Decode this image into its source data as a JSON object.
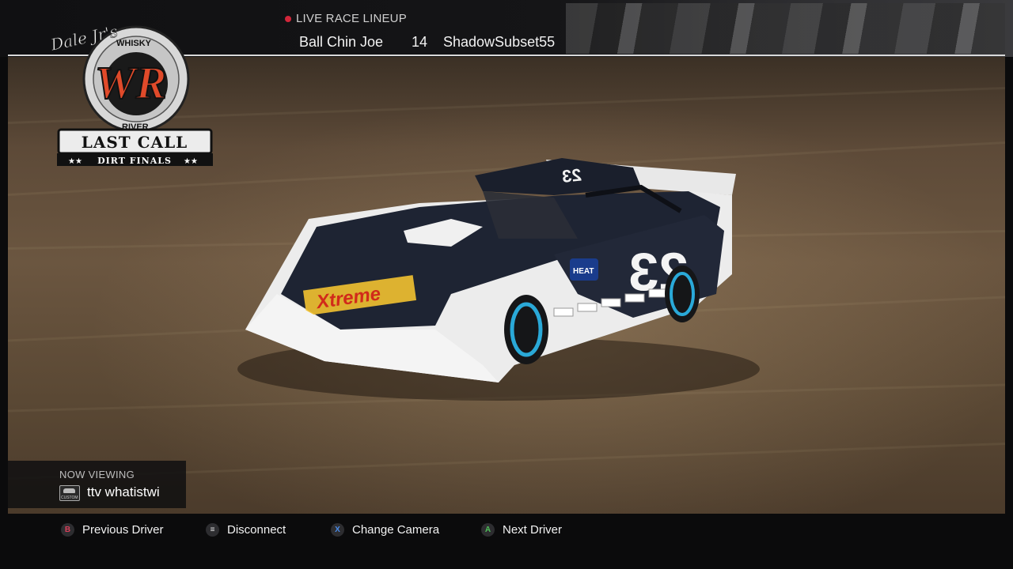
{
  "header": {
    "live_label": "LIVE RACE LINEUP",
    "lineup": {
      "driver_left": "Ball Chin Joe",
      "position": "14",
      "driver_right": "ShadowSubset55"
    },
    "live_dot_color": "#d2263a"
  },
  "logo": {
    "script": "Dale Jr's",
    "brand_top": "WHISKY",
    "monogram": "WR",
    "brand_bottom": "RIVER",
    "title": "LAST CALL",
    "subtitle": "DIRT FINALS"
  },
  "car": {
    "number": "23",
    "sponsor": "Xtreme",
    "decal": "HEAT"
  },
  "now_viewing": {
    "label": "NOW VIEWING",
    "badge": "CUSTOM",
    "driver": "ttv whatistwi"
  },
  "controls": [
    {
      "button": "B",
      "label": "Previous Driver",
      "color": "#d8405a",
      "icon": "b-button-icon"
    },
    {
      "button": "≡",
      "label": "Disconnect",
      "color": "#e6e6e6",
      "icon": "menu-button-icon"
    },
    {
      "button": "X",
      "label": "Change Camera",
      "color": "#4a8be8",
      "icon": "x-button-icon"
    },
    {
      "button": "A",
      "label": "Next Driver",
      "color": "#4fbf5a",
      "icon": "a-button-icon"
    }
  ]
}
